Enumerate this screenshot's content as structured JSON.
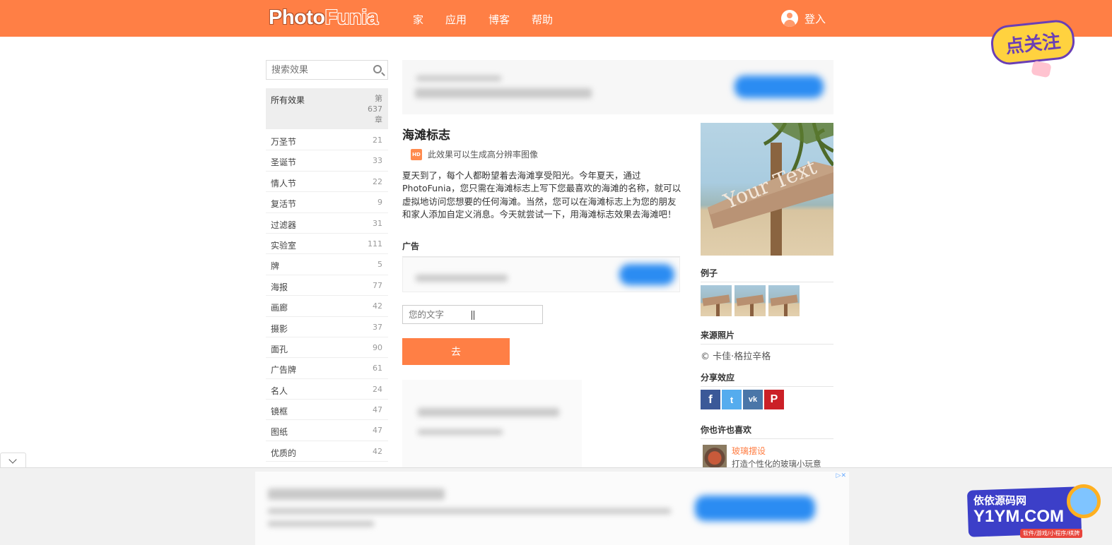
{
  "header": {
    "logo_part1": "Photo",
    "logo_part2": "Funia",
    "nav": [
      "家",
      "应用",
      "博客",
      "帮助"
    ],
    "login_label": "登入",
    "accent_color": "#ff7f45"
  },
  "sticker": {
    "text": "点关注"
  },
  "sidebar": {
    "search_placeholder": "搜索效果",
    "all_label": "所有效果",
    "all_count_line1": "第",
    "all_count_line2": "637",
    "all_count_line3": "章",
    "categories": [
      {
        "label": "万圣节",
        "count": "21"
      },
      {
        "label": "圣诞节",
        "count": "33"
      },
      {
        "label": "情人节",
        "count": "22"
      },
      {
        "label": "复活节",
        "count": "9"
      },
      {
        "label": "过滤器",
        "count": "31"
      },
      {
        "label": "实验室",
        "count": "111"
      },
      {
        "label": "牌",
        "count": "5"
      },
      {
        "label": "海报",
        "count": "77"
      },
      {
        "label": "画廊",
        "count": "42"
      },
      {
        "label": "摄影",
        "count": "37"
      },
      {
        "label": "面孔",
        "count": "90"
      },
      {
        "label": "广告牌",
        "count": "61"
      },
      {
        "label": "名人",
        "count": "24"
      },
      {
        "label": "镜框",
        "count": "47"
      },
      {
        "label": "图纸",
        "count": "47"
      },
      {
        "label": "优质的",
        "count": "42"
      }
    ]
  },
  "main": {
    "title": "海滩标志",
    "hd_badge": "HD",
    "hd_text": "此效果可以生成高分辨率图像",
    "description": "夏天到了，每个人都盼望着去海滩享受阳光。今年夏天，通过PhotoFunia，您只需在海滩标志上写下您最喜欢的海滩的名称，就可以虚拟地访问您想要的任何海滩。当然，您可以在海滩标志上为您的朋友和家人添加自定义消息。今天就尝试一下，用海滩标志效果去海滩吧！",
    "ads_label": "广告",
    "text_placeholder": "您的文字",
    "go_label": "去"
  },
  "right": {
    "sign_text": "Your Text",
    "examples_label": "例子",
    "source_label": "来源照片",
    "copyright": "© 卡佳·格拉辛格",
    "share_label": "分享效应",
    "share_icons": [
      "facebook-icon",
      "twitter-icon",
      "vk-icon",
      "pinterest-icon"
    ],
    "share_glyphs": {
      "facebook": "f",
      "twitter": "t",
      "vk": "vk",
      "pinterest": "P"
    },
    "like_label": "你也许也喜欢",
    "like_title": "玻璃摆设",
    "like_sub": "打造个性化的玻璃小玩意"
  },
  "watermark": {
    "line1": "依依源码网",
    "line2": "Y1YM.COM",
    "line3": "软件/游戏/小程序/棋牌"
  }
}
